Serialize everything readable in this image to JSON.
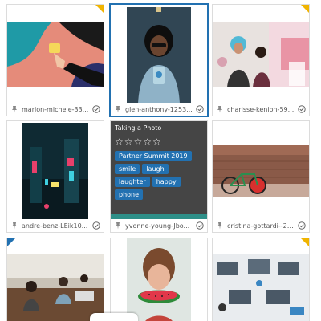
{
  "tiles": [
    {
      "filename": "marion-michele-33...",
      "corner": "top-right"
    },
    {
      "filename": "glen-anthony-1253...",
      "selected": true,
      "corner": "top-right"
    },
    {
      "filename": "charisse-kenion-59...",
      "corner": "top-right"
    },
    {
      "filename": "andre-benz-LEik10...",
      "corner": ""
    },
    {
      "filename": "yvonne-young-Jbo...",
      "corner": ""
    },
    {
      "filename": "cristina-gottardi--23...",
      "corner": ""
    },
    {
      "filename": "",
      "corner": "top-left"
    },
    {
      "filename": "",
      "corner": ""
    },
    {
      "filename": "",
      "corner": "top-right"
    }
  ],
  "overlay": {
    "title": "Taking a Photo",
    "stars": "☆☆☆☆☆",
    "tags": [
      "Partner Summit 2019",
      "smile",
      "laugh",
      "laughter",
      "happy",
      "phone"
    ]
  },
  "colors": {
    "selected_border": "#2271b1",
    "tag_bg": "#2271b1",
    "corner_yellow": "#f0b400",
    "corner_blue": "#2271b1",
    "overlay_bg": "#464646"
  }
}
